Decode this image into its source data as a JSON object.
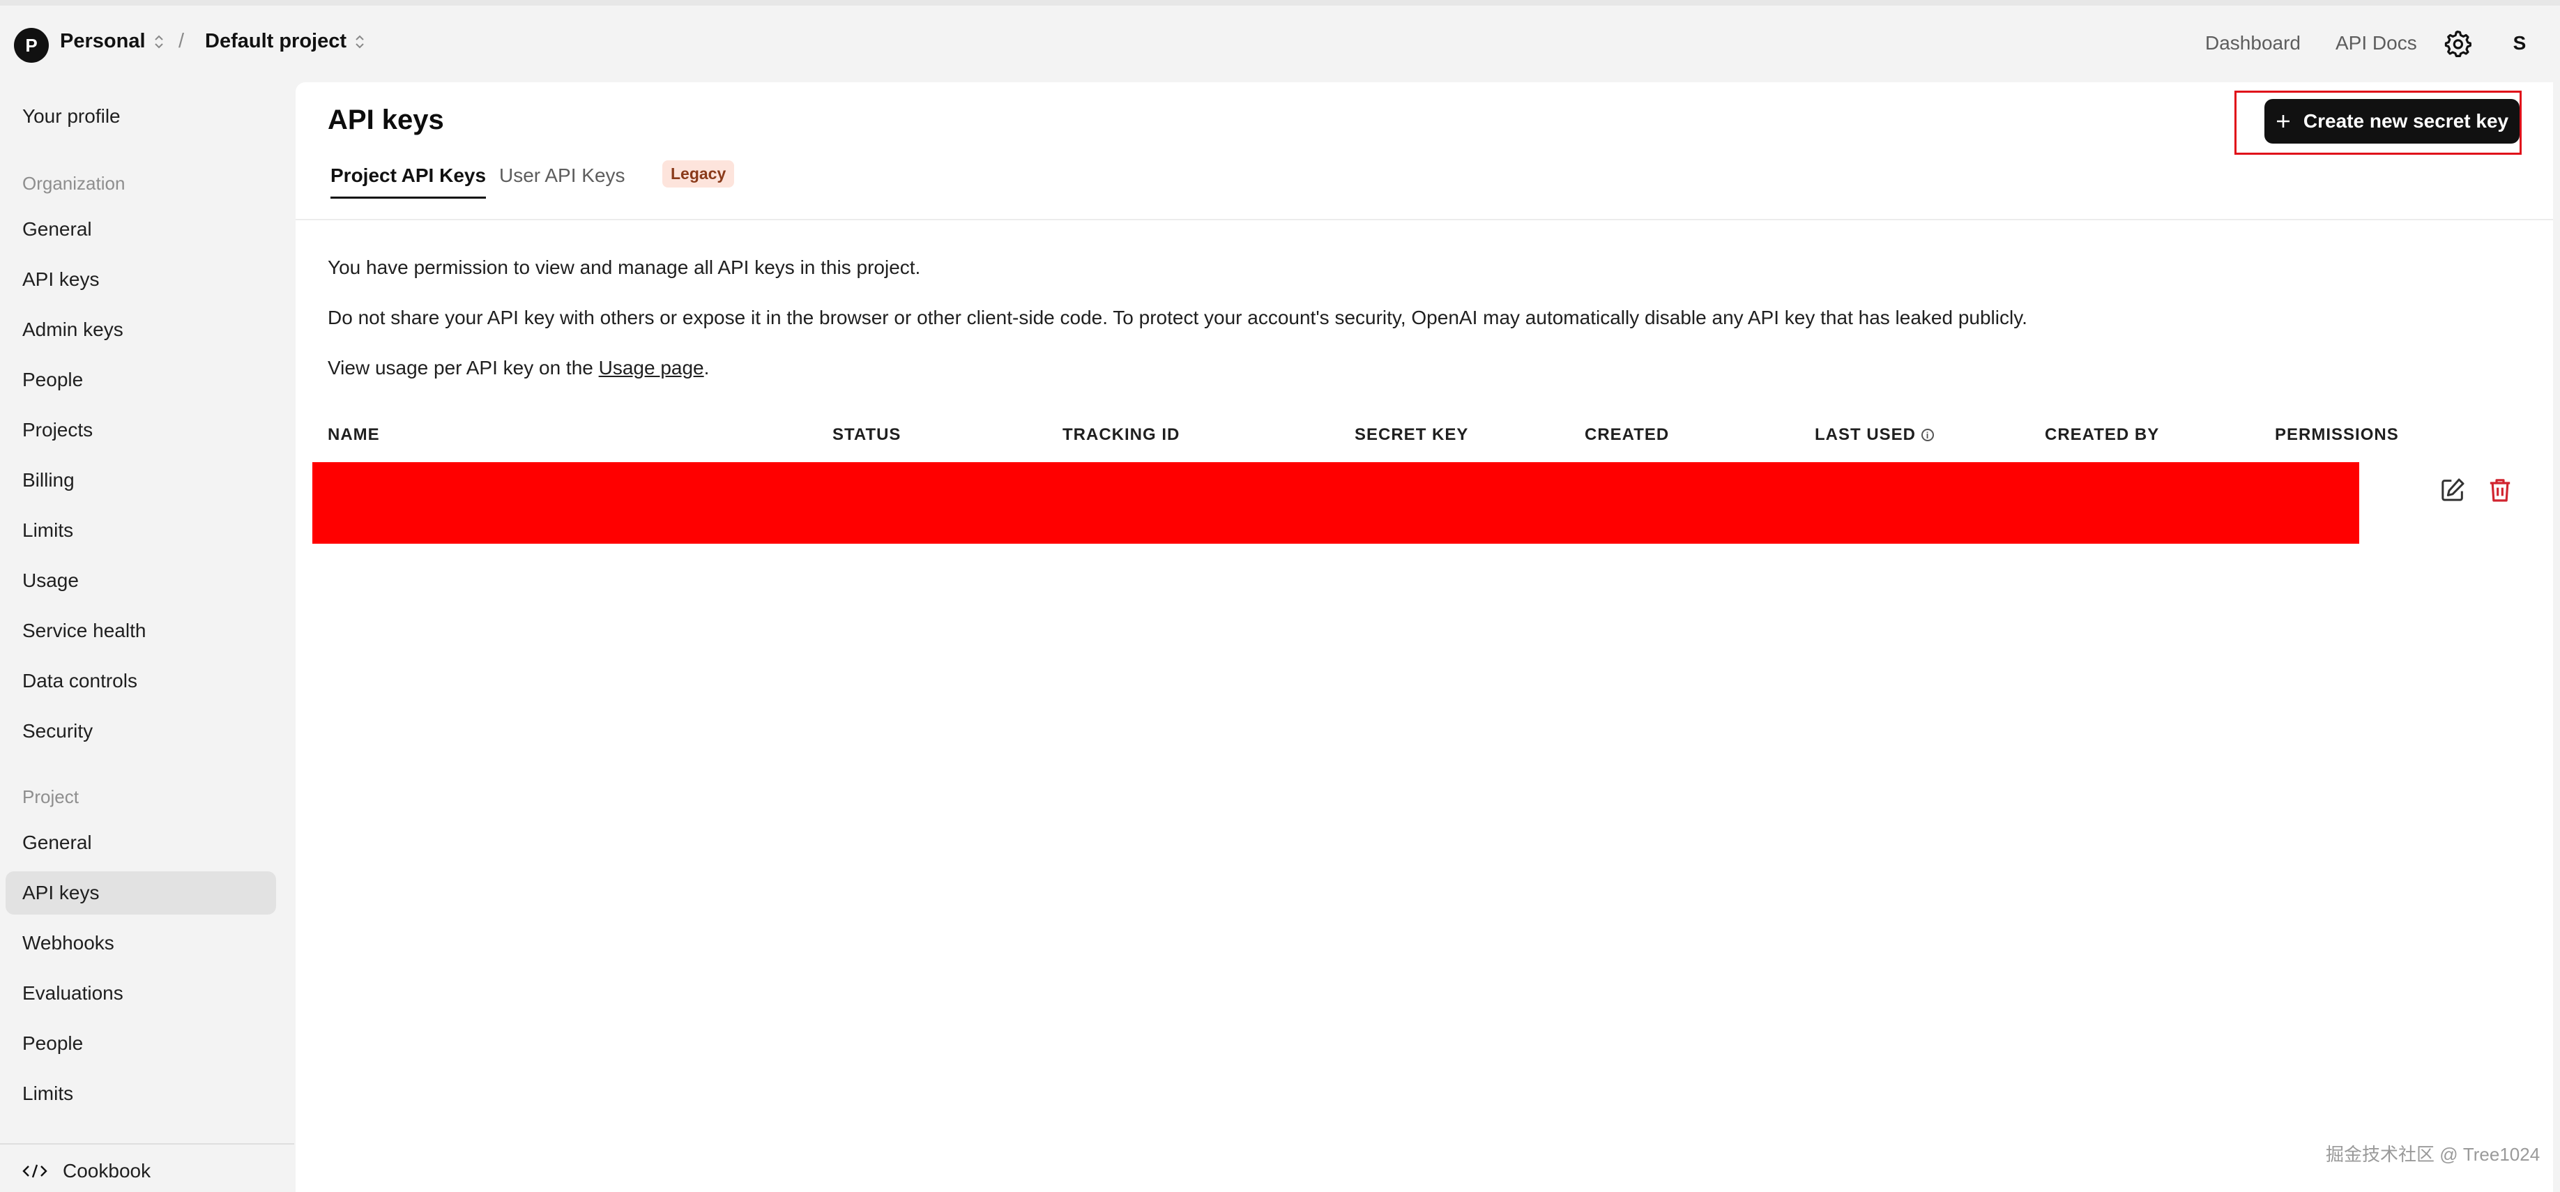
{
  "header": {
    "org_initial": "P",
    "org_name": "Personal",
    "separator": "/",
    "project_name": "Default project",
    "dashboard_link": "Dashboard",
    "api_docs_link": "API Docs",
    "user_initial": "S"
  },
  "sidebar": {
    "profile": "Your profile",
    "org_heading": "Organization",
    "org_items": [
      "General",
      "API keys",
      "Admin keys",
      "People",
      "Projects",
      "Billing",
      "Limits",
      "Usage",
      "Service health",
      "Data controls",
      "Security"
    ],
    "project_heading": "Project",
    "project_items": [
      "General",
      "API keys",
      "Webhooks",
      "Evaluations",
      "People",
      "Limits"
    ],
    "cookbook": "Cookbook"
  },
  "main": {
    "title": "API keys",
    "create_button": "Create new secret key",
    "tabs": {
      "project": "Project API Keys",
      "user": "User API Keys",
      "legacy_badge": "Legacy"
    },
    "permission_text": "You have permission to view and manage all API keys in this project.",
    "security_text": "Do not share your API key with others or expose it in the browser or other client-side code. To protect your account's security, OpenAI may automatically disable any API key that has leaked publicly.",
    "usage_prefix": "View usage per API key on the ",
    "usage_link": "Usage page",
    "usage_suffix": ".",
    "table_headers": [
      "NAME",
      "STATUS",
      "TRACKING ID",
      "SECRET KEY",
      "CREATED",
      "LAST USED",
      "CREATED BY",
      "PERMISSIONS"
    ]
  },
  "watermark": "掘金技术社区 @ Tree1024",
  "colors": {
    "primary_button": "#111111",
    "highlight_outline": "#e0101a",
    "redaction": "#ff0000",
    "delete_icon": "#d1242f",
    "legacy_badge_bg": "#fde4dc"
  }
}
